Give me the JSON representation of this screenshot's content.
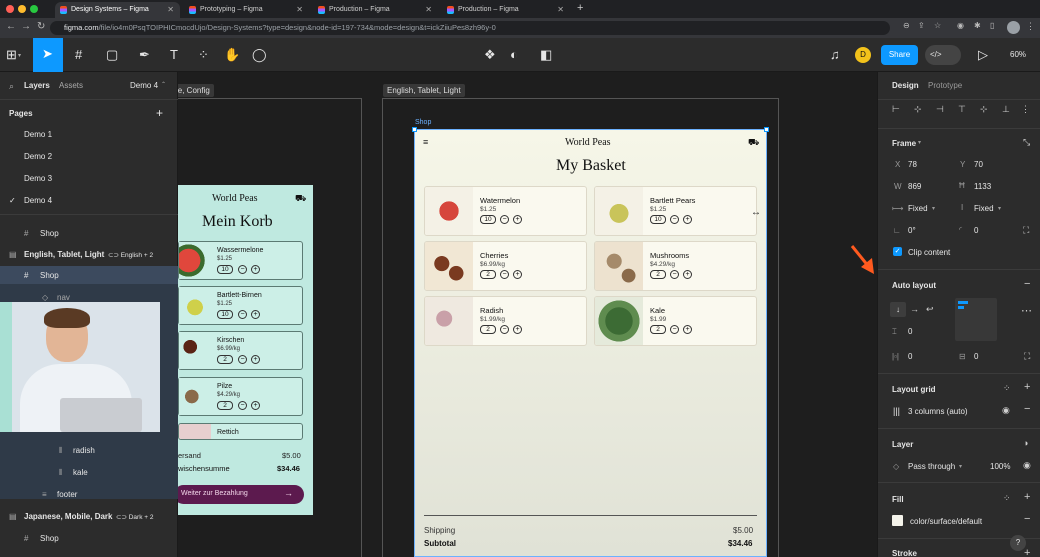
{
  "browser": {
    "tabs": [
      {
        "title": "Design Systems – Figma",
        "active": true
      },
      {
        "title": "Prototyping – Figma",
        "active": false
      },
      {
        "title": "Production – Figma",
        "active": false
      },
      {
        "title": "Production – Figma",
        "active": false
      }
    ],
    "new_tab": "+",
    "url_host": "figma.com",
    "url_path": "/file/io4m0PsqTOIPHICmocdUjo/Design-Systems?type=design&node-id=197-734&mode=design&t=ickZiiuPes8zh96y-0"
  },
  "toolbar": {
    "share_label": "Share",
    "avatar_initial": "D",
    "zoom": "60%",
    "dev_mode_glyph": "</>"
  },
  "left_panel": {
    "tabs": {
      "layers": "Layers",
      "assets": "Assets",
      "page_select": "Demo 4"
    },
    "pages_title": "Pages",
    "pages": [
      "Demo 1",
      "Demo 2",
      "Demo 3",
      "Demo 4"
    ],
    "current_page": "Demo 4",
    "layers": [
      {
        "label": "Shop"
      },
      {
        "label": "English, Tablet, Light",
        "badge": "English + 2"
      },
      {
        "label": "Shop"
      },
      {
        "label": "nav"
      },
      {
        "label": "radish"
      },
      {
        "label": "kale"
      },
      {
        "label": "footer"
      },
      {
        "label": "Japanese, Mobile, Dark",
        "badge": "Dark + 2"
      },
      {
        "label": "Shop"
      }
    ]
  },
  "canvas": {
    "frame_labels": [
      "le, Config",
      "English, Tablet, Light"
    ],
    "shop_label": "Shop",
    "mobile": {
      "brand": "World Peas",
      "title": "Mein Korb",
      "items": [
        {
          "name": "Wassermelone",
          "price": "$1.25",
          "qty": "10"
        },
        {
          "name": "Bartlett-Birnen",
          "price": "$1.25",
          "qty": "10"
        },
        {
          "name": "Kirschen",
          "price": "$6.99/kg",
          "qty": "2"
        },
        {
          "name": "Pilze",
          "price": "$4.29/kg",
          "qty": "2"
        },
        {
          "name": "Rettich",
          "price": "",
          "qty": ""
        }
      ],
      "shipping_label": "ersand",
      "shipping_value": "$5.00",
      "subtotal_label": "wischensumme",
      "subtotal_value": "$34.46",
      "checkout": "Weiter zur Bezahlung"
    },
    "tablet": {
      "brand": "World Peas",
      "title": "My Basket",
      "items": [
        {
          "name": "Watermelon",
          "price": "$1.25",
          "qty": "10",
          "color": "#d6463c"
        },
        {
          "name": "Bartlett Pears",
          "price": "$1.25",
          "qty": "10",
          "color": "#c9c45a"
        },
        {
          "name": "Cherries",
          "price": "$6.99/kg",
          "qty": "2",
          "color": "#7a3a20"
        },
        {
          "name": "Mushrooms",
          "price": "$4.29/kg",
          "qty": "2",
          "color": "#a58a6a"
        },
        {
          "name": "Radish",
          "price": "$1.99/kg",
          "qty": "2",
          "color": "#c9a0a8"
        },
        {
          "name": "Kale",
          "price": "$1.99",
          "qty": "2",
          "color": "#3c6b34"
        }
      ],
      "shipping_label": "Shipping",
      "shipping_value": "$5.00",
      "subtotal_label": "Subtotal",
      "subtotal_value": "$34.46"
    }
  },
  "right_panel": {
    "tabs": {
      "design": "Design",
      "prototype": "Prototype"
    },
    "frame": {
      "title": "Frame",
      "x_label": "X",
      "x": "78",
      "y_label": "Y",
      "y": "70",
      "w_label": "W",
      "w": "869",
      "h": "1133",
      "w_mode": "Fixed",
      "h_mode": "Fixed",
      "rotation": "0°",
      "radius": "0",
      "clip_content": "Clip content"
    },
    "auto_layout": {
      "title": "Auto layout",
      "gap": "0",
      "padding_h": "0",
      "padding_v": "0"
    },
    "layout_grid": {
      "title": "Layout grid",
      "value": "3 columns (auto)"
    },
    "layer": {
      "title": "Layer",
      "blend": "Pass through",
      "opacity": "100%"
    },
    "fill": {
      "title": "Fill",
      "style": "color/surface/default"
    },
    "stroke": {
      "title": "Stroke"
    },
    "help": "?"
  },
  "colors": {
    "accent": "#0d99ff",
    "arrow": "#ff5a1f",
    "mobile_bg": "#bfe9e0",
    "checkout_bg": "#5c1a4e"
  }
}
